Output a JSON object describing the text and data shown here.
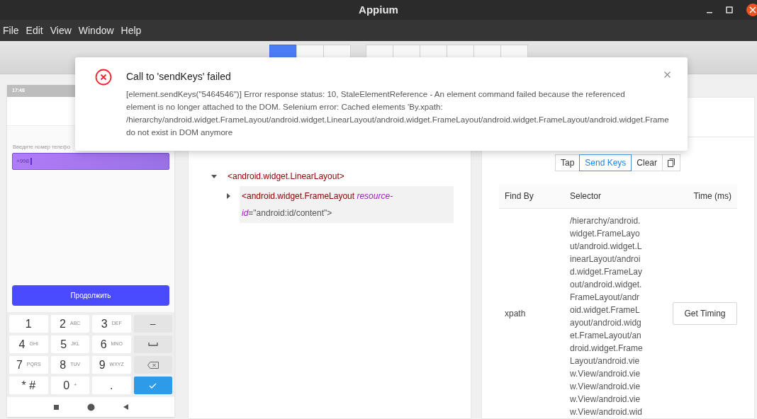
{
  "window": {
    "title": "Appium"
  },
  "menu": [
    "File",
    "Edit",
    "View",
    "Window",
    "Help"
  ],
  "toolbar": {
    "groups": [
      [
        {
          "selected": true
        },
        {
          "selected": false
        },
        {
          "selected": false
        }
      ],
      [
        {
          "selected": false
        },
        {
          "selected": false
        },
        {
          "selected": false
        },
        {
          "selected": false
        },
        {
          "selected": false
        },
        {
          "selected": false
        }
      ]
    ]
  },
  "device": {
    "status_time": "17:48",
    "phone_label": "Введите номер телефо",
    "phone_value": "+998",
    "continue_button": "Продолжить",
    "keys": [
      {
        "kind": "digit",
        "main": "1"
      },
      {
        "kind": "digit",
        "main": "2",
        "sub": "ABC"
      },
      {
        "kind": "digit",
        "main": "3",
        "sub": "DEF"
      },
      {
        "kind": "symbol",
        "main": "–"
      },
      {
        "kind": "digit",
        "main": "4",
        "sub": "GHI"
      },
      {
        "kind": "digit",
        "main": "5",
        "sub": "JKL"
      },
      {
        "kind": "digit",
        "main": "6",
        "sub": "MNO"
      },
      {
        "kind": "space"
      },
      {
        "kind": "digit",
        "main": "7",
        "sub": "PQRS"
      },
      {
        "kind": "digit",
        "main": "8",
        "sub": "TUV"
      },
      {
        "kind": "digit",
        "main": "9",
        "sub": "WXYZ"
      },
      {
        "kind": "backspace"
      },
      {
        "kind": "digit",
        "main": "* #"
      },
      {
        "kind": "digit",
        "main": "0",
        "sub": "+"
      },
      {
        "kind": "digit",
        "main": "."
      },
      {
        "kind": "done"
      }
    ]
  },
  "tree": [
    {
      "expanded": true,
      "selected": false,
      "segments": [
        {
          "kind": "tag",
          "text": "<android.widget.LinearLayout>"
        }
      ],
      "children": [
        {
          "expanded": false,
          "selected": true,
          "segments": [
            {
              "kind": "tag",
              "text": "<android.widget.FrameLayout"
            },
            {
              "kind": "attr",
              "text": "resource-id"
            },
            {
              "kind": "value",
              "text": "=\"android:id/content\">"
            }
          ]
        }
      ]
    }
  ],
  "actions": [
    {
      "label": "Tap",
      "selected": false
    },
    {
      "label": "Send Keys",
      "selected": true
    },
    {
      "label": "Clear",
      "selected": false
    },
    {
      "kind": "copy",
      "selected": false
    }
  ],
  "table": {
    "columns": [
      "Find By",
      "Selector",
      "Time (ms)"
    ],
    "rows": [
      {
        "find_by": "xpath",
        "selector": "/hierarchy/android.widget.FrameLayout/android.widget.LinearLayout/android.widget.FrameLayout/android.widget.FrameLayout/android.widget.FrameLayout/android.widget.FrameLayout/android.widget.FrameLayout/android.view.View/android.view.View/android.view.View/android.view.View/android.wid",
        "button": "Get Timing"
      }
    ]
  },
  "dialog": {
    "title": "Call to 'sendKeys' failed",
    "lines": [
      "[element.sendKeys(\"5464546\")] Error response status: 10, StaleElementReference - An element command failed because the referenced",
      "element is no longer attached to the DOM. Selenium error: Cached elements 'By.xpath:",
      "/hierarchy/android.widget.FrameLayout/android.widget.LinearLayout/android.widget.FrameLayout/android.widget.FrameLayout/android.widget.Frame",
      "do not exist in DOM anymore"
    ]
  }
}
